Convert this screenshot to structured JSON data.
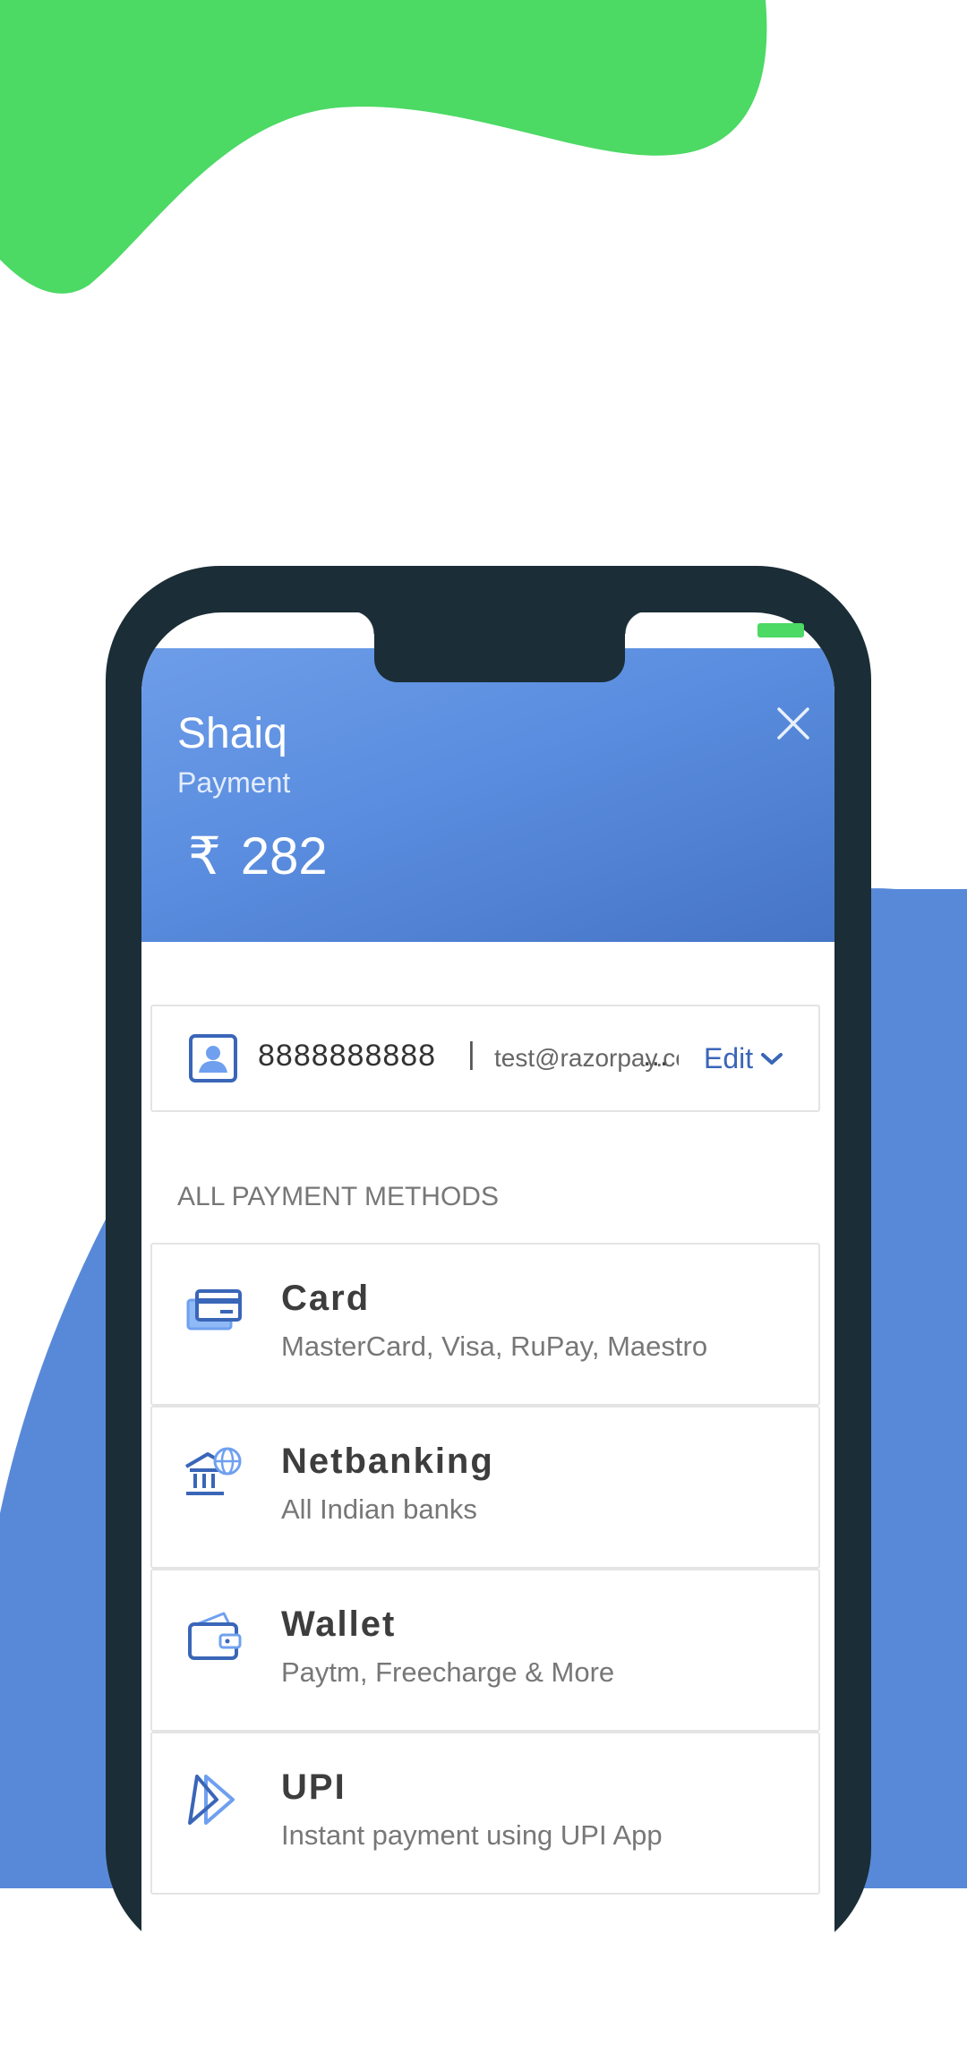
{
  "colors": {
    "green_blob": "#4cd964",
    "blue_blob": "#5889d9",
    "phone_frame": "#1b2d36",
    "accent": "#3a66b8"
  },
  "header": {
    "merchant": "Shaiq",
    "description": "Payment",
    "currency": "₹",
    "amount": "282",
    "close_icon": "close-icon"
  },
  "contact": {
    "icon": "contact-card-icon",
    "phone": "8888888888",
    "separator": "|",
    "email": "test@razorpay.com",
    "ellipsis": "...",
    "edit_label": "Edit"
  },
  "section_title": "ALL PAYMENT METHODS",
  "methods": [
    {
      "icon": "card-icon",
      "title": "Card",
      "subtitle": "MasterCard, Visa, RuPay, Maestro"
    },
    {
      "icon": "bank-globe-icon",
      "title": "Netbanking",
      "subtitle": "All Indian banks"
    },
    {
      "icon": "wallet-icon",
      "title": "Wallet",
      "subtitle": "Paytm, Freecharge & More"
    },
    {
      "icon": "upi-icon",
      "title": "UPI",
      "subtitle": "Instant payment using UPI App"
    }
  ]
}
